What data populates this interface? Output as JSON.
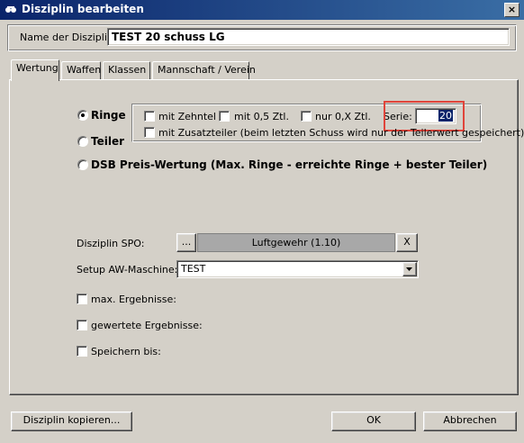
{
  "window": {
    "title": "Disziplin bearbeiten",
    "close": "×"
  },
  "name_field": {
    "label": "Name der Disziplin:",
    "value": "TEST 20 schuss LG"
  },
  "tabs": [
    {
      "label": "Wertung",
      "active": true
    },
    {
      "label": "Waffen",
      "active": false
    },
    {
      "label": "Klassen",
      "active": false
    },
    {
      "label": "Mannschaft / Verein",
      "active": false
    }
  ],
  "wertung": {
    "ringe": {
      "label": "Ringe",
      "checked": true
    },
    "teiler": {
      "label": "Teiler",
      "checked": false
    },
    "dsb": {
      "label": "DSB Preis-Wertung (Max. Ringe - erreichte Ringe + bester Teiler)",
      "checked": false
    },
    "options": {
      "zehntel": "mit Zehntel",
      "ztl05": "mit 0,5 Ztl.",
      "ztl0x": "nur 0,X Ztl.",
      "serie_label": "Serie:",
      "serie_value": "20",
      "zusatzteiler": "mit Zusatzteiler (beim letzten Schuss wird nur der Teilerwert gespeichert)"
    },
    "spo": {
      "label": "Disziplin SPO:",
      "browse": "...",
      "value": "Luftgewehr (1.10)",
      "clear": "X"
    },
    "setup": {
      "label": "Setup AW-Maschine:",
      "value": "TEST"
    },
    "max_ergebnisse": "max. Ergebnisse:",
    "gewertete_ergebnisse": "gewertete Ergebnisse:",
    "speichern_bis": "Speichern bis:"
  },
  "buttons": {
    "kopieren": "Disziplin kopieren...",
    "ok": "OK",
    "abbrechen": "Abbrechen"
  },
  "colors": {
    "titlebar": "#0a246a",
    "highlight": "#e0443a",
    "face": "#d4d0c8"
  }
}
